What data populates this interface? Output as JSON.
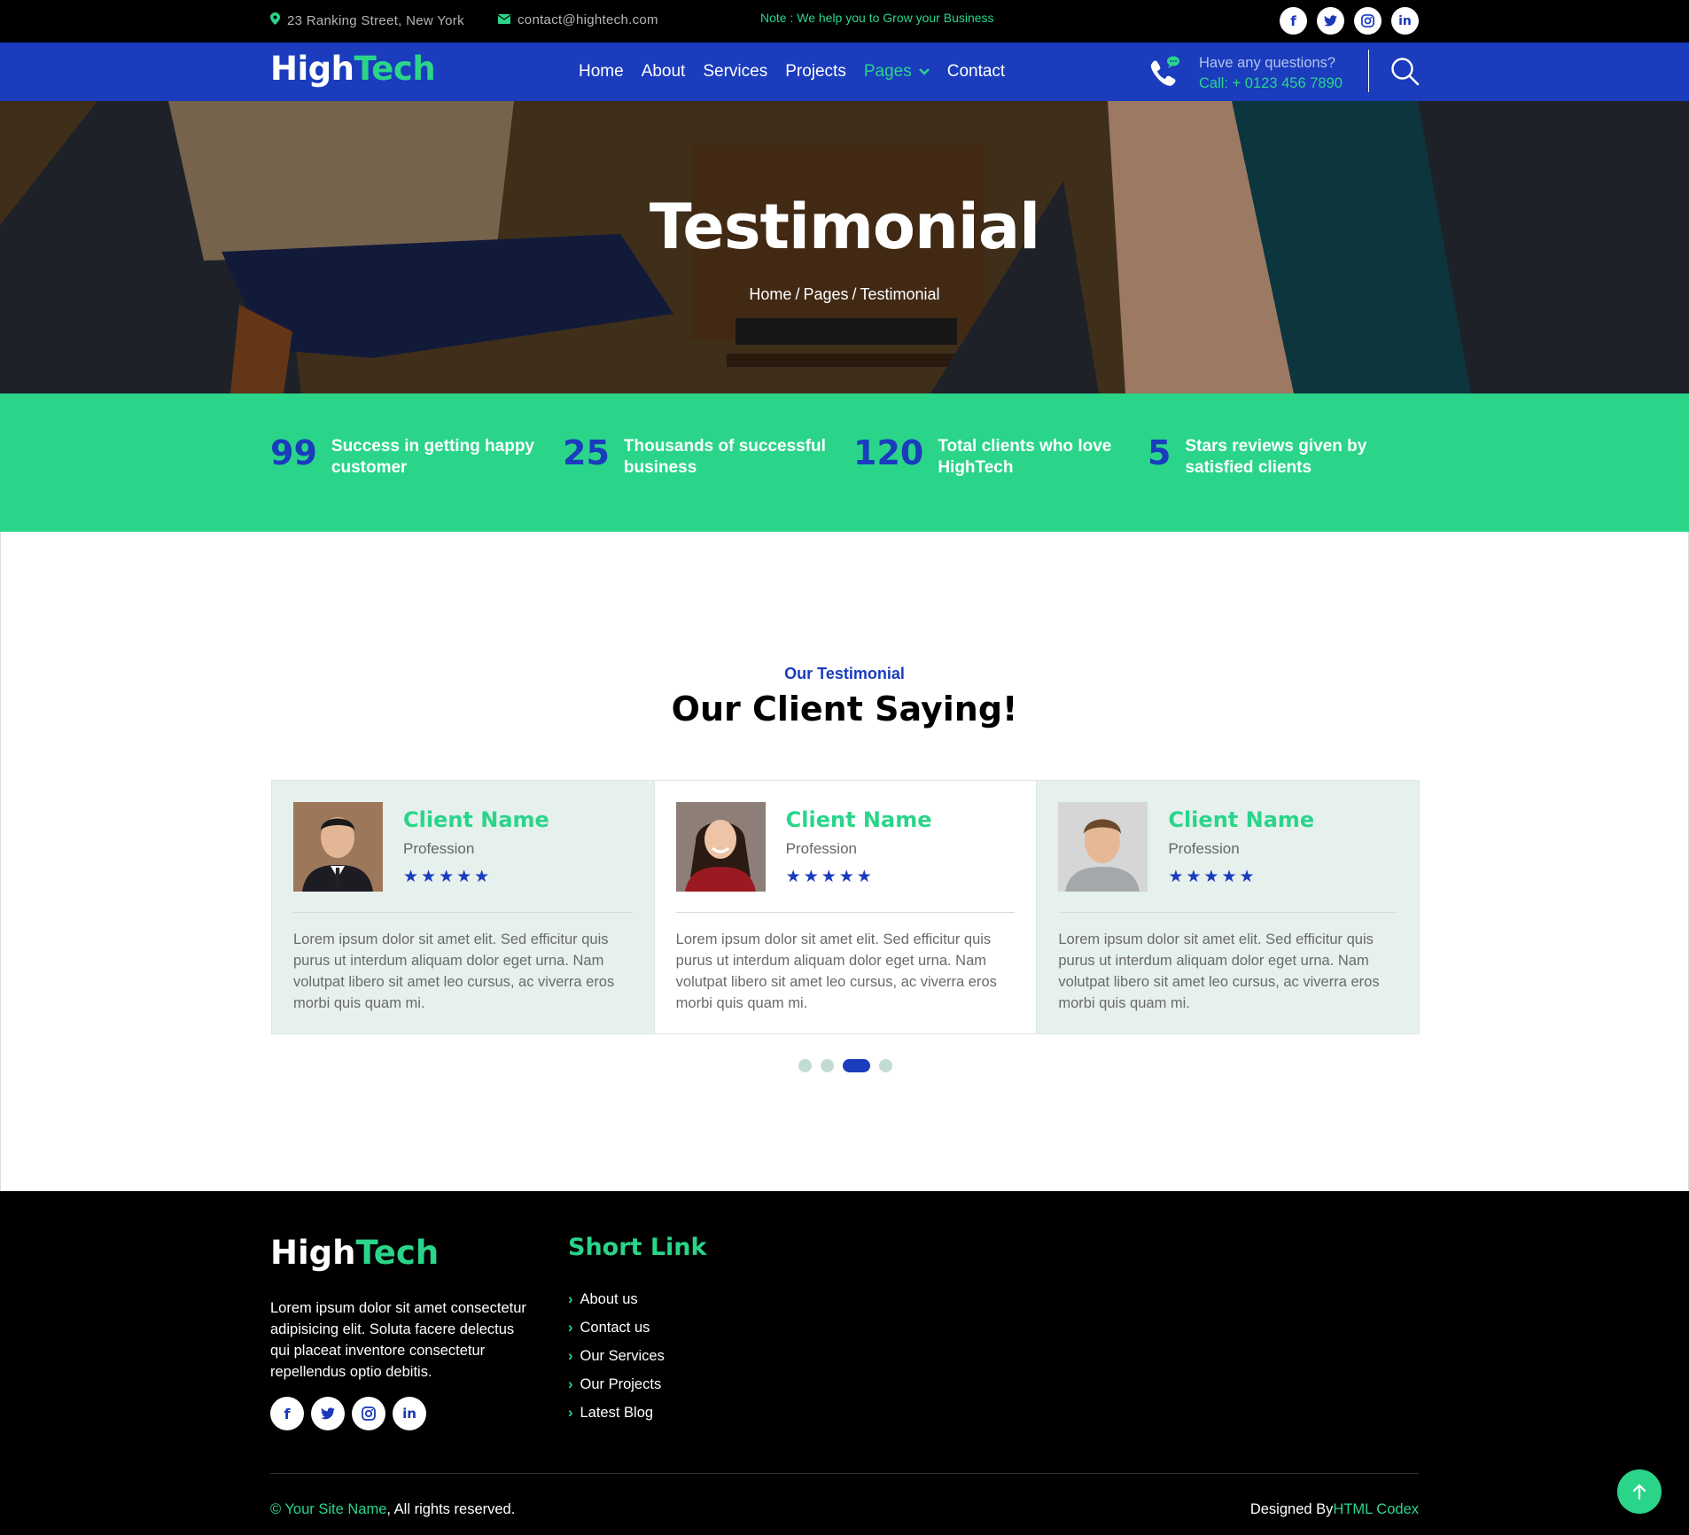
{
  "topbar": {
    "address": "23 Ranking Street, New York",
    "email": "contact@hightech.com",
    "note": "Note : We help you to Grow your Business",
    "socials": [
      "f",
      "t",
      "◎",
      "in"
    ]
  },
  "nav": {
    "logo_a": "High",
    "logo_b": "Tech",
    "items": [
      "Home",
      "About",
      "Services",
      "Projects",
      "Pages",
      "Contact"
    ],
    "question": "Have any questions?",
    "call": "Call: + 0123 456 7890"
  },
  "hero": {
    "title": "Testimonial",
    "crumbs": [
      "Home",
      "Pages",
      "Testimonial"
    ]
  },
  "stats": [
    {
      "num": "99",
      "text": "Success in getting happy customer"
    },
    {
      "num": "25",
      "text": "Thousands of successful business"
    },
    {
      "num": "120",
      "text": "Total clients who love HighTech"
    },
    {
      "num": "5",
      "text": "Stars reviews given by satisfied clients"
    }
  ],
  "testimonial": {
    "subtitle": "Our Testimonial",
    "title": "Our Client Saying!",
    "cards": [
      {
        "name": "Client Name",
        "profession": "Profession",
        "stars": "★★★★★",
        "text": "Lorem ipsum dolor sit amet elit. Sed efficitur quis purus ut interdum aliquam dolor eget urna. Nam volutpat libero sit amet leo cursus, ac viverra eros morbi quis quam mi."
      },
      {
        "name": "Client Name",
        "profession": "Profession",
        "stars": "★★★★★",
        "text": "Lorem ipsum dolor sit amet elit. Sed efficitur quis purus ut interdum aliquam dolor eget urna. Nam volutpat libero sit amet leo cursus, ac viverra eros morbi quis quam mi."
      },
      {
        "name": "Client Name",
        "profession": "Profession",
        "stars": "★★★★★",
        "text": "Lorem ipsum dolor sit amet elit. Sed efficitur quis purus ut interdum aliquam dolor eget urna. Nam volutpat libero sit amet leo cursus, ac viverra eros morbi quis quam mi."
      }
    ],
    "active_dot": 3
  },
  "footer": {
    "logo_a": "High",
    "logo_b": "Tech",
    "desc": "Lorem ipsum dolor sit amet consectetur adipisicing elit. Soluta facere delectus qui placeat inventore consectetur repellendus optio debitis.",
    "short_link_title": "Short Link",
    "links": [
      "About us",
      "Contact us",
      "Our Services",
      "Our Projects",
      "Latest Blog"
    ],
    "copyright_site": "© Your Site Name",
    "copyright_rest": ", All rights reserved.",
    "designed_by": "Designed By",
    "designer": "HTML Codex"
  },
  "colors": {
    "primary": "#1a3cbd",
    "accent": "#2ad58a",
    "dark": "#000000"
  }
}
